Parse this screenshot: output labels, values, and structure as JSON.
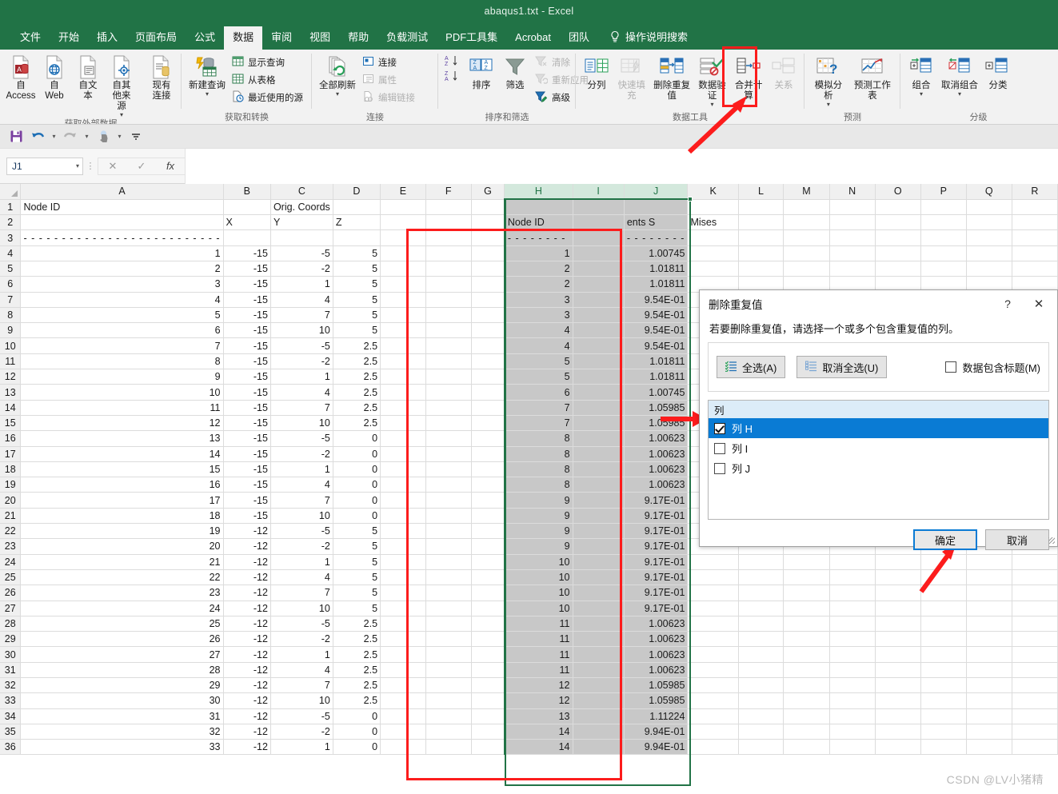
{
  "titlebar": {
    "title": "abaqus1.txt  -  Excel"
  },
  "ribbon_tabs": [
    {
      "label": "文件",
      "active": false
    },
    {
      "label": "开始",
      "active": false
    },
    {
      "label": "插入",
      "active": false
    },
    {
      "label": "页面布局",
      "active": false
    },
    {
      "label": "公式",
      "active": false
    },
    {
      "label": "数据",
      "active": true
    },
    {
      "label": "审阅",
      "active": false
    },
    {
      "label": "视图",
      "active": false
    },
    {
      "label": "帮助",
      "active": false
    },
    {
      "label": "负载测试",
      "active": false
    },
    {
      "label": "PDF工具集",
      "active": false
    },
    {
      "label": "Acrobat",
      "active": false
    },
    {
      "label": "团队",
      "active": false
    }
  ],
  "tell_me": {
    "label": "操作说明搜索",
    "icon": "lightbulb-icon"
  },
  "ribbon_groups": [
    {
      "name": "获取外部数据",
      "big_buttons": [
        {
          "label": "自 Access",
          "icon": "from-access-icon",
          "disabled": false
        },
        {
          "label": "自 Web",
          "icon": "from-web-icon",
          "disabled": false
        },
        {
          "label": "自文本",
          "icon": "from-text-icon",
          "disabled": false
        },
        {
          "label": "自其他来源",
          "icon": "from-other-sources-icon",
          "disabled": false,
          "dropdown": true
        },
        {
          "label": "现有连接",
          "icon": "existing-connections-icon",
          "disabled": false
        }
      ]
    },
    {
      "name": "获取和转换",
      "big_buttons": [
        {
          "label": "新建查询",
          "icon": "new-query-icon",
          "disabled": false,
          "dropdown": true
        }
      ],
      "small_buttons": [
        {
          "label": "显示查询",
          "icon": "show-queries-icon",
          "disabled": false
        },
        {
          "label": "从表格",
          "icon": "from-table-icon",
          "disabled": false
        },
        {
          "label": "最近使用的源",
          "icon": "recent-sources-icon",
          "disabled": false
        }
      ]
    },
    {
      "name": "连接",
      "big_buttons": [
        {
          "label": "全部刷新",
          "icon": "refresh-all-icon",
          "disabled": false,
          "dropdown": true
        }
      ],
      "small_buttons": [
        {
          "label": "连接",
          "icon": "connections-icon",
          "disabled": false
        },
        {
          "label": "属性",
          "icon": "properties-icon",
          "disabled": true
        },
        {
          "label": "编辑链接",
          "icon": "edit-links-icon",
          "disabled": true
        }
      ]
    },
    {
      "name": "排序和筛选",
      "big_buttons": [
        {
          "label": "排序",
          "icon": "sort-icon",
          "disabled": false
        },
        {
          "label": "筛选",
          "icon": "filter-icon",
          "disabled": false
        }
      ],
      "small_buttons": [
        {
          "label": "清除",
          "icon": "clear-filter-icon",
          "disabled": true
        },
        {
          "label": "重新应用",
          "icon": "reapply-icon",
          "disabled": true
        },
        {
          "label": "高级",
          "icon": "advanced-filter-icon",
          "disabled": false
        }
      ]
    },
    {
      "name": "数据工具",
      "big_buttons": [
        {
          "label": "分列",
          "icon": "text-to-columns-icon",
          "disabled": false
        },
        {
          "label": "快速填充",
          "icon": "flash-fill-icon",
          "disabled": true
        },
        {
          "label": "删除重复值",
          "icon": "remove-duplicates-icon",
          "disabled": false
        },
        {
          "label": "数据验证",
          "icon": "data-validation-icon",
          "disabled": false,
          "dropdown": true
        },
        {
          "label": "合并计算",
          "icon": "consolidate-icon",
          "disabled": false
        },
        {
          "label": "关系",
          "icon": "relationships-icon",
          "disabled": true
        }
      ]
    },
    {
      "name": "预测",
      "big_buttons": [
        {
          "label": "模拟分析",
          "icon": "what-if-analysis-icon",
          "disabled": false,
          "dropdown": true
        },
        {
          "label": "预测工作表",
          "icon": "forecast-sheet-icon",
          "disabled": false
        }
      ]
    },
    {
      "name": "分级",
      "big_buttons": [
        {
          "label": "组合",
          "icon": "group-icon",
          "disabled": false,
          "dropdown": true
        },
        {
          "label": "取消组合",
          "icon": "ungroup-icon",
          "disabled": false,
          "dropdown": true
        },
        {
          "label": "分类",
          "icon": "subtotal-icon",
          "disabled": false
        }
      ]
    }
  ],
  "quick_access": [
    {
      "icon": "save-icon",
      "name": "save"
    },
    {
      "icon": "undo-icon",
      "name": "undo"
    },
    {
      "icon": "redo-icon",
      "name": "redo"
    },
    {
      "icon": "touch-mode-icon",
      "name": "touch-mode"
    },
    {
      "icon": "customize-qat-icon",
      "name": "customize"
    }
  ],
  "formula_bar": {
    "name_box_value": "J1",
    "cancel_icon": "cancel-icon",
    "confirm_icon": "confirm-icon",
    "fx_label": "fx",
    "formula_value": ""
  },
  "grid": {
    "column_headers": [
      "A",
      "B",
      "C",
      "D",
      "E",
      "F",
      "G",
      "H",
      "I",
      "J",
      "K",
      "L",
      "M",
      "N",
      "O",
      "P",
      "Q",
      "R"
    ],
    "selected_columns": [
      "H",
      "I",
      "J"
    ],
    "row_numbers": [
      1,
      2,
      3,
      4,
      5,
      6,
      7,
      8,
      9,
      10,
      11,
      12,
      13,
      14,
      15,
      16,
      17,
      18,
      19,
      20,
      21,
      22,
      23,
      24,
      25,
      26,
      27,
      28,
      29,
      30,
      31,
      32,
      33,
      34,
      35,
      36
    ],
    "left_block": {
      "headers_row1": {
        "A": "Node ID",
        "C": "Orig. Coords"
      },
      "headers_row2": {
        "B": "X",
        "C": "Y",
        "D": "Z"
      },
      "separator_row": "- - - - - - - - - - - - - - - - - - - - - - - - - -",
      "rows": [
        {
          "row": 4,
          "A": "1",
          "B": "-15",
          "C": "-5",
          "D": "5"
        },
        {
          "row": 5,
          "A": "2",
          "B": "-15",
          "C": "-2",
          "D": "5"
        },
        {
          "row": 6,
          "A": "3",
          "B": "-15",
          "C": "1",
          "D": "5"
        },
        {
          "row": 7,
          "A": "4",
          "B": "-15",
          "C": "4",
          "D": "5"
        },
        {
          "row": 8,
          "A": "5",
          "B": "-15",
          "C": "7",
          "D": "5"
        },
        {
          "row": 9,
          "A": "6",
          "B": "-15",
          "C": "10",
          "D": "5"
        },
        {
          "row": 10,
          "A": "7",
          "B": "-15",
          "C": "-5",
          "D": "2.5"
        },
        {
          "row": 11,
          "A": "8",
          "B": "-15",
          "C": "-2",
          "D": "2.5"
        },
        {
          "row": 12,
          "A": "9",
          "B": "-15",
          "C": "1",
          "D": "2.5"
        },
        {
          "row": 13,
          "A": "10",
          "B": "-15",
          "C": "4",
          "D": "2.5"
        },
        {
          "row": 14,
          "A": "11",
          "B": "-15",
          "C": "7",
          "D": "2.5"
        },
        {
          "row": 15,
          "A": "12",
          "B": "-15",
          "C": "10",
          "D": "2.5"
        },
        {
          "row": 16,
          "A": "13",
          "B": "-15",
          "C": "-5",
          "D": "0"
        },
        {
          "row": 17,
          "A": "14",
          "B": "-15",
          "C": "-2",
          "D": "0"
        },
        {
          "row": 18,
          "A": "15",
          "B": "-15",
          "C": "1",
          "D": "0"
        },
        {
          "row": 19,
          "A": "16",
          "B": "-15",
          "C": "4",
          "D": "0"
        },
        {
          "row": 20,
          "A": "17",
          "B": "-15",
          "C": "7",
          "D": "0"
        },
        {
          "row": 21,
          "A": "18",
          "B": "-15",
          "C": "10",
          "D": "0"
        },
        {
          "row": 22,
          "A": "19",
          "B": "-12",
          "C": "-5",
          "D": "5"
        },
        {
          "row": 23,
          "A": "20",
          "B": "-12",
          "C": "-2",
          "D": "5"
        },
        {
          "row": 24,
          "A": "21",
          "B": "-12",
          "C": "1",
          "D": "5"
        },
        {
          "row": 25,
          "A": "22",
          "B": "-12",
          "C": "4",
          "D": "5"
        },
        {
          "row": 26,
          "A": "23",
          "B": "-12",
          "C": "7",
          "D": "5"
        },
        {
          "row": 27,
          "A": "24",
          "B": "-12",
          "C": "10",
          "D": "5"
        },
        {
          "row": 28,
          "A": "25",
          "B": "-12",
          "C": "-5",
          "D": "2.5"
        },
        {
          "row": 29,
          "A": "26",
          "B": "-12",
          "C": "-2",
          "D": "2.5"
        },
        {
          "row": 30,
          "A": "27",
          "B": "-12",
          "C": "1",
          "D": "2.5"
        },
        {
          "row": 31,
          "A": "28",
          "B": "-12",
          "C": "4",
          "D": "2.5"
        },
        {
          "row": 32,
          "A": "29",
          "B": "-12",
          "C": "7",
          "D": "2.5"
        },
        {
          "row": 33,
          "A": "30",
          "B": "-12",
          "C": "10",
          "D": "2.5"
        },
        {
          "row": 34,
          "A": "31",
          "B": "-12",
          "C": "-5",
          "D": "0"
        },
        {
          "row": 35,
          "A": "32",
          "B": "-12",
          "C": "-2",
          "D": "0"
        },
        {
          "row": 36,
          "A": "33",
          "B": "-12",
          "C": "1",
          "D": "0"
        }
      ]
    },
    "right_block": {
      "headers_row2": {
        "H": "Node ID",
        "J": "ents          S",
        "K": "Mises"
      },
      "separator_row": "- - - - - - - -",
      "rows": [
        {
          "row": 4,
          "H": "1",
          "J": "1.00745"
        },
        {
          "row": 5,
          "H": "2",
          "J": "1.01811"
        },
        {
          "row": 6,
          "H": "2",
          "J": "1.01811"
        },
        {
          "row": 7,
          "H": "3",
          "J": "9.54E-01"
        },
        {
          "row": 8,
          "H": "3",
          "J": "9.54E-01"
        },
        {
          "row": 9,
          "H": "4",
          "J": "9.54E-01"
        },
        {
          "row": 10,
          "H": "4",
          "J": "9.54E-01"
        },
        {
          "row": 11,
          "H": "5",
          "J": "1.01811"
        },
        {
          "row": 12,
          "H": "5",
          "J": "1.01811"
        },
        {
          "row": 13,
          "H": "6",
          "J": "1.00745"
        },
        {
          "row": 14,
          "H": "7",
          "J": "1.05985"
        },
        {
          "row": 15,
          "H": "7",
          "J": "1.05985"
        },
        {
          "row": 16,
          "H": "8",
          "J": "1.00623"
        },
        {
          "row": 17,
          "H": "8",
          "J": "1.00623"
        },
        {
          "row": 18,
          "H": "8",
          "J": "1.00623"
        },
        {
          "row": 19,
          "H": "8",
          "J": "1.00623"
        },
        {
          "row": 20,
          "H": "9",
          "J": "9.17E-01"
        },
        {
          "row": 21,
          "H": "9",
          "J": "9.17E-01"
        },
        {
          "row": 22,
          "H": "9",
          "J": "9.17E-01"
        },
        {
          "row": 23,
          "H": "9",
          "J": "9.17E-01"
        },
        {
          "row": 24,
          "H": "10",
          "J": "9.17E-01"
        },
        {
          "row": 25,
          "H": "10",
          "J": "9.17E-01"
        },
        {
          "row": 26,
          "H": "10",
          "J": "9.17E-01"
        },
        {
          "row": 27,
          "H": "10",
          "J": "9.17E-01"
        },
        {
          "row": 28,
          "H": "11",
          "J": "1.00623"
        },
        {
          "row": 29,
          "H": "11",
          "J": "1.00623"
        },
        {
          "row": 30,
          "H": "11",
          "J": "1.00623"
        },
        {
          "row": 31,
          "H": "11",
          "J": "1.00623"
        },
        {
          "row": 32,
          "H": "12",
          "J": "1.05985"
        },
        {
          "row": 33,
          "H": "12",
          "J": "1.05985"
        },
        {
          "row": 34,
          "H": "13",
          "J": "1.11224"
        },
        {
          "row": 35,
          "H": "14",
          "J": "9.94E-01"
        },
        {
          "row": 36,
          "H": "14",
          "J": "9.94E-01"
        }
      ]
    }
  },
  "dialog": {
    "title": "删除重复值",
    "help_icon": "question-mark-icon",
    "close_icon": "close-icon",
    "description": "若要删除重复值，请选择一个或多个包含重复值的列。",
    "select_all_label": "全选(A)",
    "unselect_all_label": "取消全选(U)",
    "has_headers_label": "数据包含标题(M)",
    "has_headers_checked": false,
    "list_header": "列",
    "columns": [
      {
        "label": "列 H",
        "checked": true,
        "selected": true
      },
      {
        "label": "列 I",
        "checked": false,
        "selected": false
      },
      {
        "label": "列 J",
        "checked": false,
        "selected": false
      }
    ],
    "ok_label": "确定",
    "cancel_label": "取消"
  },
  "watermark": {
    "text": "CSDN @LV小猪精"
  },
  "colors": {
    "excel_green": "#217346",
    "annotation_red": "#fc1c1c",
    "selection_blue": "#0a7bd4",
    "selection_gray": "#c8c8c8"
  }
}
